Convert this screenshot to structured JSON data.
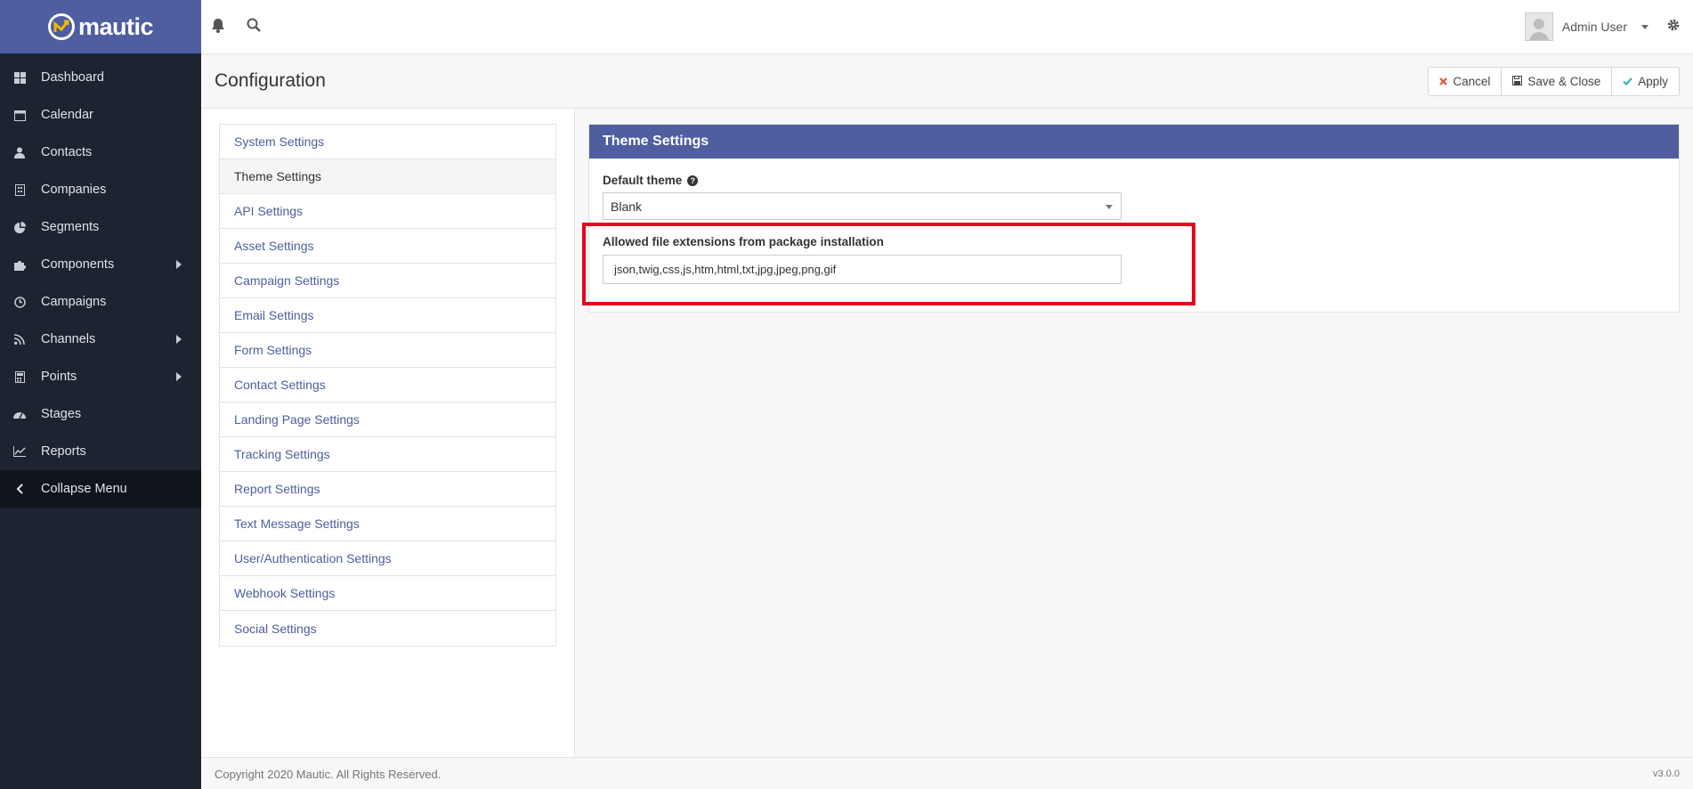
{
  "brand": {
    "name": "mautic"
  },
  "sidebar": {
    "items": [
      {
        "label": "Dashboard",
        "icon": "dashboard-icon"
      },
      {
        "label": "Calendar",
        "icon": "calendar-icon"
      },
      {
        "label": "Contacts",
        "icon": "user-icon"
      },
      {
        "label": "Companies",
        "icon": "building-icon"
      },
      {
        "label": "Segments",
        "icon": "pie-chart-icon"
      },
      {
        "label": "Components",
        "icon": "puzzle-icon",
        "submenu": true
      },
      {
        "label": "Campaigns",
        "icon": "clock-icon"
      },
      {
        "label": "Channels",
        "icon": "rss-icon",
        "submenu": true
      },
      {
        "label": "Points",
        "icon": "calculator-icon",
        "submenu": true
      },
      {
        "label": "Stages",
        "icon": "tachometer-icon"
      },
      {
        "label": "Reports",
        "icon": "line-chart-icon"
      }
    ],
    "collapse_label": "Collapse Menu"
  },
  "topbar": {
    "user_name": "Admin User"
  },
  "page": {
    "title": "Configuration",
    "buttons": {
      "cancel": "Cancel",
      "save_close": "Save & Close",
      "apply": "Apply"
    }
  },
  "settings_nav": {
    "items": [
      "System Settings",
      "Theme Settings",
      "API Settings",
      "Asset Settings",
      "Campaign Settings",
      "Email Settings",
      "Form Settings",
      "Contact Settings",
      "Landing Page Settings",
      "Tracking Settings",
      "Report Settings",
      "Text Message Settings",
      "User/Authentication Settings",
      "Webhook Settings",
      "Social Settings"
    ],
    "active_index": 1
  },
  "theme_panel": {
    "heading": "Theme Settings",
    "default_theme_label": "Default theme",
    "default_theme_value": "Blank",
    "extensions_label": "Allowed file extensions from package installation",
    "extensions_value": "json,twig,css,js,htm,html,txt,jpg,jpeg,png,gif"
  },
  "footer": {
    "copyright": "Copyright 2020 Mautic. All Rights Reserved.",
    "version": "v3.0.0"
  },
  "colors": {
    "brand": "#4e5e9e",
    "sidebar_bg": "#1c2431",
    "highlight": "#e8001c",
    "cancel_icon": "#e8562a",
    "apply_icon": "#35b4b9"
  }
}
